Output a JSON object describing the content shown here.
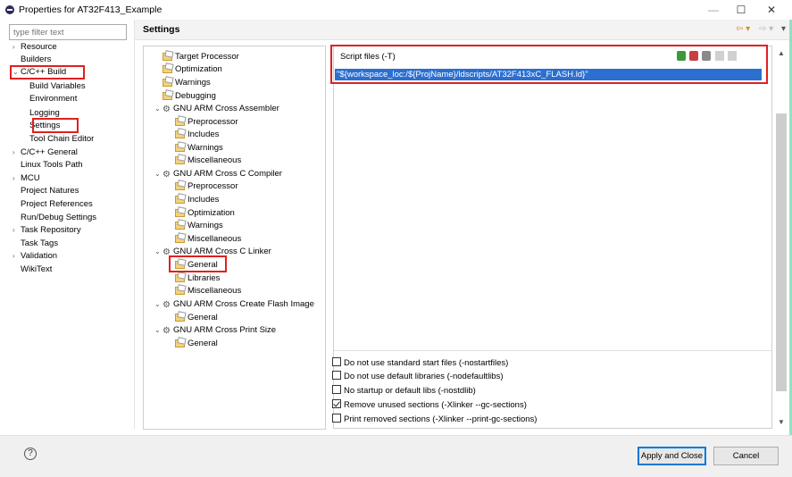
{
  "window": {
    "title": "Properties for AT32F413_Example",
    "minimize_label": "—",
    "maximize_label": "☐",
    "close_label": "✕"
  },
  "filter": {
    "placeholder": "type filter text"
  },
  "nav": {
    "items": [
      {
        "label": "Resource",
        "chevron": "›"
      },
      {
        "label": "Builders",
        "chevron": ""
      },
      {
        "label": "C/C++ Build",
        "chevron": "⌄"
      },
      {
        "label": "Build Variables",
        "chevron": ""
      },
      {
        "label": "Environment",
        "chevron": ""
      },
      {
        "label": "Logging",
        "chevron": ""
      },
      {
        "label": "Settings",
        "chevron": ""
      },
      {
        "label": "Tool Chain Editor",
        "chevron": ""
      },
      {
        "label": "C/C++ General",
        "chevron": "›"
      },
      {
        "label": "Linux Tools Path",
        "chevron": ""
      },
      {
        "label": "MCU",
        "chevron": "›"
      },
      {
        "label": "Project Natures",
        "chevron": ""
      },
      {
        "label": "Project References",
        "chevron": ""
      },
      {
        "label": "Run/Debug Settings",
        "chevron": ""
      },
      {
        "label": "Task Repository",
        "chevron": "›"
      },
      {
        "label": "Task Tags",
        "chevron": ""
      },
      {
        "label": "Validation",
        "chevron": "›"
      },
      {
        "label": "WikiText",
        "chevron": ""
      }
    ]
  },
  "settings": {
    "title": "Settings",
    "back_icon": "⇦ ▾",
    "forward_icon": "⇨ ▾",
    "menu_icon": "▾"
  },
  "tree": {
    "items": [
      {
        "label": "Target Processor",
        "toggle": "",
        "kind": "tool"
      },
      {
        "label": "Optimization",
        "toggle": "",
        "kind": "tool"
      },
      {
        "label": "Warnings",
        "toggle": "",
        "kind": "tool"
      },
      {
        "label": "Debugging",
        "toggle": "",
        "kind": "tool"
      },
      {
        "label": "GNU ARM Cross Assembler",
        "toggle": "⌄",
        "kind": "group"
      },
      {
        "label": "Preprocessor",
        "toggle": "",
        "kind": "tool"
      },
      {
        "label": "Includes",
        "toggle": "",
        "kind": "tool"
      },
      {
        "label": "Warnings",
        "toggle": "",
        "kind": "tool"
      },
      {
        "label": "Miscellaneous",
        "toggle": "",
        "kind": "tool"
      },
      {
        "label": "GNU ARM Cross C Compiler",
        "toggle": "⌄",
        "kind": "group"
      },
      {
        "label": "Preprocessor",
        "toggle": "",
        "kind": "tool"
      },
      {
        "label": "Includes",
        "toggle": "",
        "kind": "tool"
      },
      {
        "label": "Optimization",
        "toggle": "",
        "kind": "tool"
      },
      {
        "label": "Warnings",
        "toggle": "",
        "kind": "tool"
      },
      {
        "label": "Miscellaneous",
        "toggle": "",
        "kind": "tool"
      },
      {
        "label": "GNU ARM Cross C Linker",
        "toggle": "⌄",
        "kind": "group"
      },
      {
        "label": "General",
        "toggle": "",
        "kind": "tool"
      },
      {
        "label": "Libraries",
        "toggle": "",
        "kind": "tool"
      },
      {
        "label": "Miscellaneous",
        "toggle": "",
        "kind": "tool"
      },
      {
        "label": "GNU ARM Cross Create Flash Image",
        "toggle": "⌄",
        "kind": "group"
      },
      {
        "label": "General",
        "toggle": "",
        "kind": "tool"
      },
      {
        "label": "GNU ARM Cross Print Size",
        "toggle": "⌄",
        "kind": "group"
      },
      {
        "label": "General",
        "toggle": "",
        "kind": "tool"
      }
    ]
  },
  "script_files": {
    "label": "Script files (-T)",
    "entries": [
      "\"${workspace_loc:/${ProjName}/ldscripts/AT32F413xC_FLASH.ld}\""
    ],
    "toolbar": [
      "add-icon",
      "delete-icon",
      "edit-icon",
      "move-up-icon",
      "move-down-icon"
    ]
  },
  "options": [
    {
      "label": "Do not use standard start files (-nostartfiles)",
      "checked": false
    },
    {
      "label": "Do not use default libraries (-nodefaultlibs)",
      "checked": false
    },
    {
      "label": "No startup or default libs (-nostdlib)",
      "checked": false
    },
    {
      "label": "Remove unused sections (-Xlinker --gc-sections)",
      "checked": true
    },
    {
      "label": "Print removed sections (-Xlinker --print-gc-sections)",
      "checked": false
    }
  ],
  "footer": {
    "help_label": "?",
    "apply_label": "Apply and Close",
    "cancel_label": "Cancel"
  },
  "colors": {
    "highlight": "#e02020",
    "selection": "#2b6fd1",
    "accent_nav": "#d68d2e"
  }
}
